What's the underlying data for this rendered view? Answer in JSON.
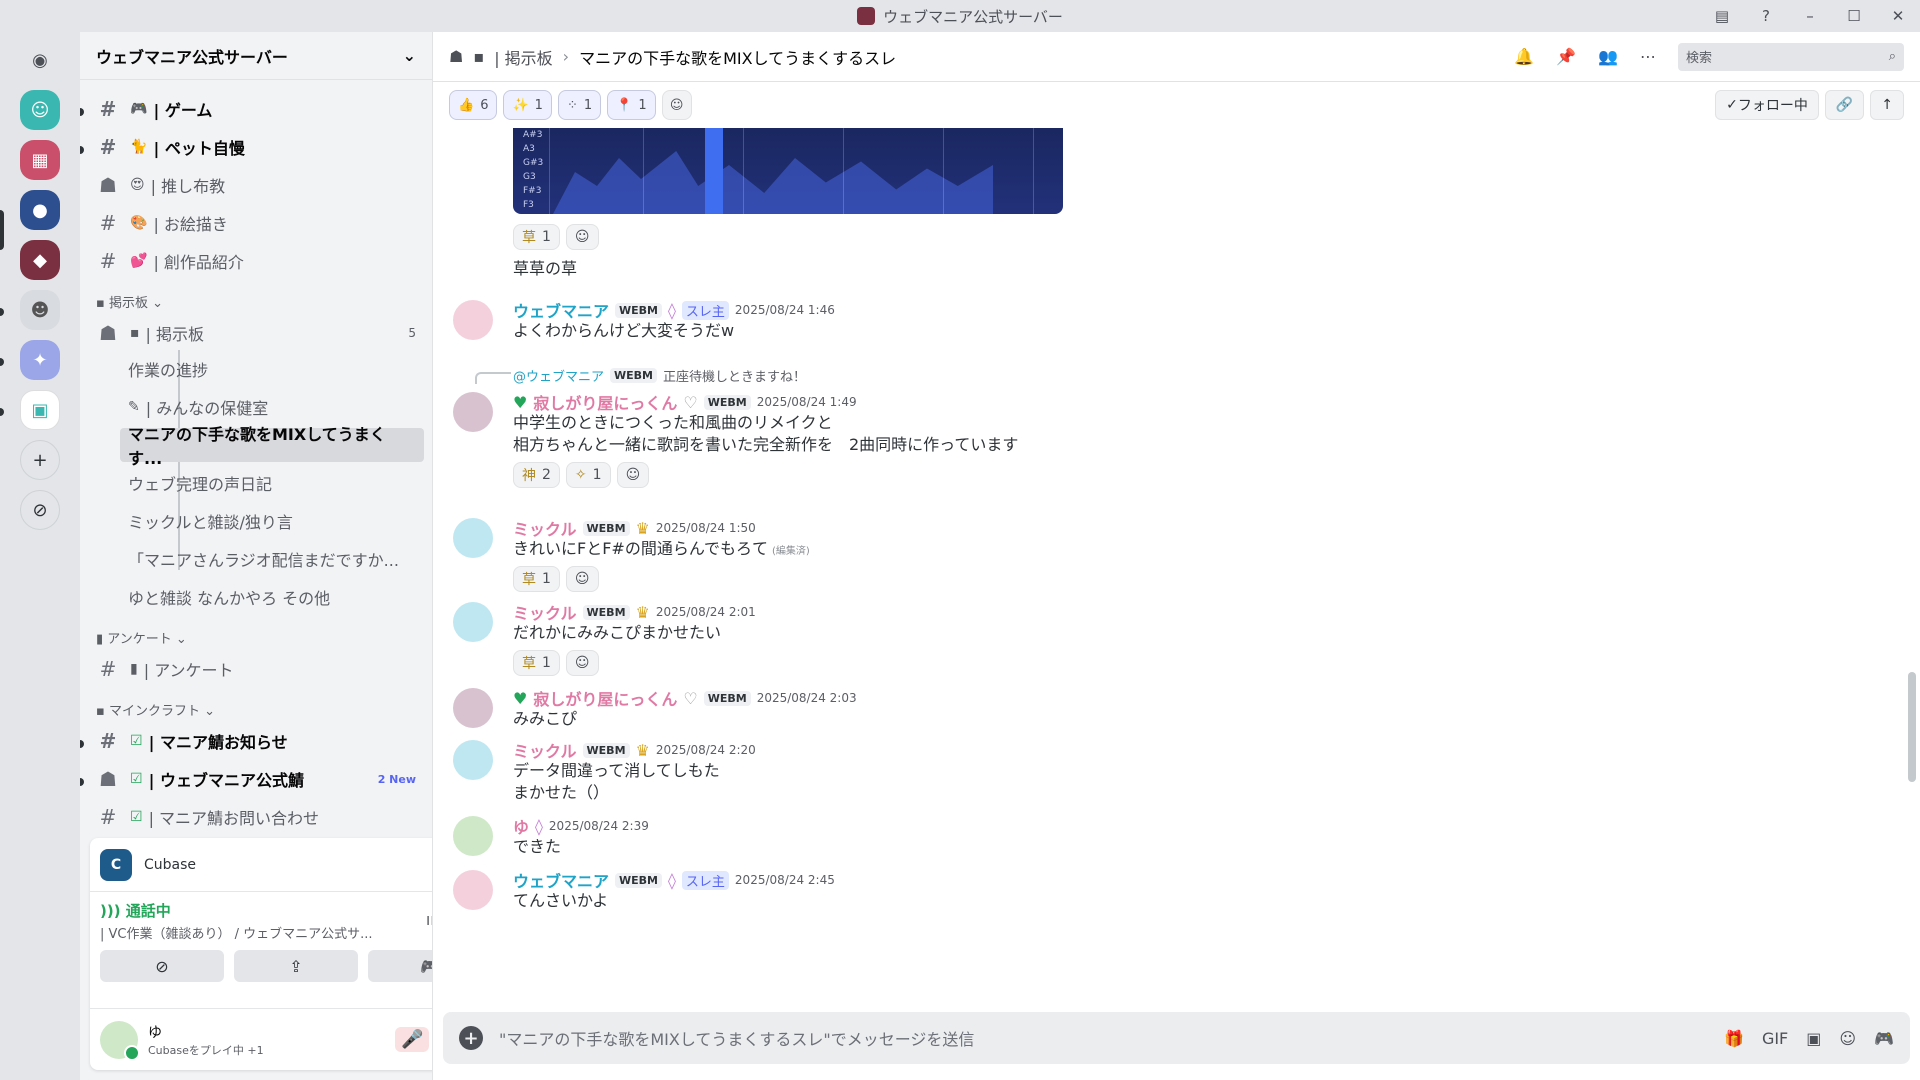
{
  "window": {
    "title": "ウェブマニア公式サーバー"
  },
  "server": {
    "name": "ウェブマニア公式サーバー"
  },
  "channels": [
    {
      "emoji": "🎮",
      "label": "| ゲーム"
    },
    {
      "emoji": "🐈",
      "label": "| ペット自慢"
    },
    {
      "emoji": "😍",
      "label": "| 推し布教"
    },
    {
      "emoji": "🎨",
      "label": "| お絵描き"
    },
    {
      "emoji": "💕",
      "label": "| 創作品紹介"
    }
  ],
  "categories": {
    "board": "掲示板",
    "survey": "アンケート",
    "minecraft": "マインクラフト"
  },
  "board_channel": {
    "label": "| 掲示板",
    "count": "5"
  },
  "threads": [
    "作業の進捗",
    "| みんなの保健室",
    "マニアの下手な歌をMIXしてうまくす...",
    "ウェブ完理の声日記",
    "ミックルと雑談/独り言",
    "「マニアさんラジオ配信まだですか...",
    "ゆと雑談 なんかやろ その他"
  ],
  "survey_channel": "| アンケート",
  "mc_channels": [
    {
      "label": "| マニア鯖お知らせ"
    },
    {
      "label": "| ウェブマニア公式鯖",
      "badge": "2 New"
    },
    {
      "label": "| マニア鯖お問い合わせ"
    }
  ],
  "activity": {
    "app": "Cubase"
  },
  "voice": {
    "status": "通話中",
    "channel": "| VC作業（雑談あり） / ウェブマニア公式サ..."
  },
  "user": {
    "name": "ゆ",
    "activity": "Cubaseをプレイ中 +1"
  },
  "header": {
    "breadcrumb_parent": "| 掲示板",
    "thread_title": "マニアの下手な歌をMIXしてうまくするスレ",
    "search_placeholder": "検索"
  },
  "top_reactions": [
    "6",
    "1",
    "1",
    "1"
  ],
  "follow_label": "フォロー中",
  "chart_labels": [
    "A#3",
    "A3",
    "G#3",
    "G3",
    "F#3",
    "F3"
  ],
  "messages": [
    {
      "rx": "1",
      "text": "草草の草"
    },
    {
      "name": "ウェブマニア",
      "color": "#1fa3c7",
      "tag": "WEBM",
      "role": "スレ主",
      "time": "2025/08/24 1:46",
      "text": "よくわからんけど大変そうだw"
    },
    {
      "reply_name": "@ウェブマニア",
      "reply_tag": "WEBM",
      "reply_text": "正座待機しときますね！",
      "name": "寂しがり屋にっくん",
      "color": "#e07aa5",
      "tag": "WEBM",
      "time": "2025/08/24 1:49",
      "text1": "中学生のときにつくった和風曲のリメイクと",
      "text2": "相方ちゃんと一緒に歌詞を書いた完全新作を　2曲同時に作っています",
      "rx1": "2",
      "rx2": "1"
    },
    {
      "name": "ミックル",
      "color": "#e07aa5",
      "tag": "WEBM",
      "time": "2025/08/24 1:50",
      "text": "きれいにFとF#の間通らんでもろて",
      "edited": "(編集済)",
      "rx": "1"
    },
    {
      "name": "ミックル",
      "color": "#e07aa5",
      "tag": "WEBM",
      "time": "2025/08/24 2:01",
      "text": "だれかにみみこぴまかせたい",
      "rx": "1"
    },
    {
      "name": "寂しがり屋にっくん",
      "color": "#e07aa5",
      "tag": "WEBM",
      "time": "2025/08/24 2:03",
      "text": "みみこぴ"
    },
    {
      "name": "ミックル",
      "color": "#e07aa5",
      "tag": "WEBM",
      "time": "2025/08/24 2:20",
      "text1": "データ間違って消してしもた",
      "text2": "まかせた（）"
    },
    {
      "name": "ゆ",
      "color": "#e07aa5",
      "time": "2025/08/24 2:39",
      "text": "できた"
    },
    {
      "name": "ウェブマニア",
      "color": "#1fa3c7",
      "tag": "WEBM",
      "role": "スレ主",
      "time": "2025/08/24 2:45",
      "text": "てんさいかよ"
    }
  ],
  "composer": {
    "placeholder": "\"マニアの下手な歌をMIXしてうまくするスレ\"でメッセージを送信"
  }
}
